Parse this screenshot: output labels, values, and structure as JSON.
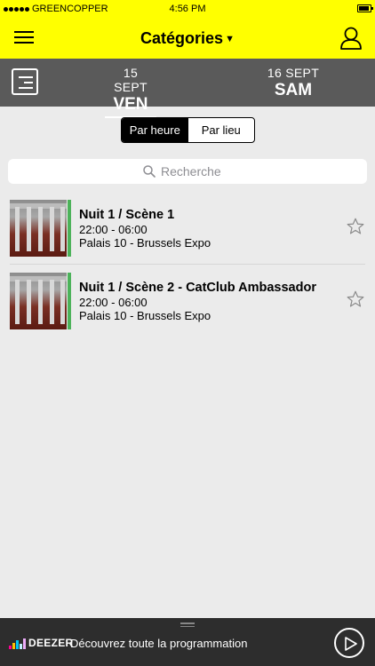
{
  "status_bar": {
    "carrier": "GREENCOPPER",
    "time": "4:56 PM",
    "battery_level": 0.9
  },
  "nav": {
    "title": "Catégories",
    "menu_icon": "hamburger-icon",
    "profile_icon": "user-icon"
  },
  "days": [
    {
      "date": "15 SEPT",
      "name": "VEN",
      "active": true
    },
    {
      "date": "16 SEPT",
      "name": "SAM",
      "active": false
    }
  ],
  "segment": {
    "options": [
      "Par heure",
      "Par lieu"
    ],
    "selected": 0
  },
  "search": {
    "placeholder": "Recherche",
    "value": ""
  },
  "events": [
    {
      "title": "Nuit 1 / Scène 1",
      "hours": "22:00 - 06:00",
      "place": "Palais 10 - Brussels Expo",
      "accent_color": "#4cb25a",
      "favorited": false
    },
    {
      "title": "Nuit 1 / Scène 2 - CatClub Ambassador",
      "hours": "22:00 - 06:00",
      "place": "Palais 10 - Brussels Expo",
      "accent_color": "#4cb25a",
      "favorited": false
    }
  ],
  "bottom_bar": {
    "brand": "DEEZER",
    "promo": "Découvrez toute la programmation"
  },
  "colors": {
    "nav_bg": "#ffff00",
    "day_bar_bg": "#5a5a5a",
    "page_bg": "#ebebeb",
    "bottom_bg": "#2d2d2d",
    "accent_green": "#4cb25a"
  }
}
